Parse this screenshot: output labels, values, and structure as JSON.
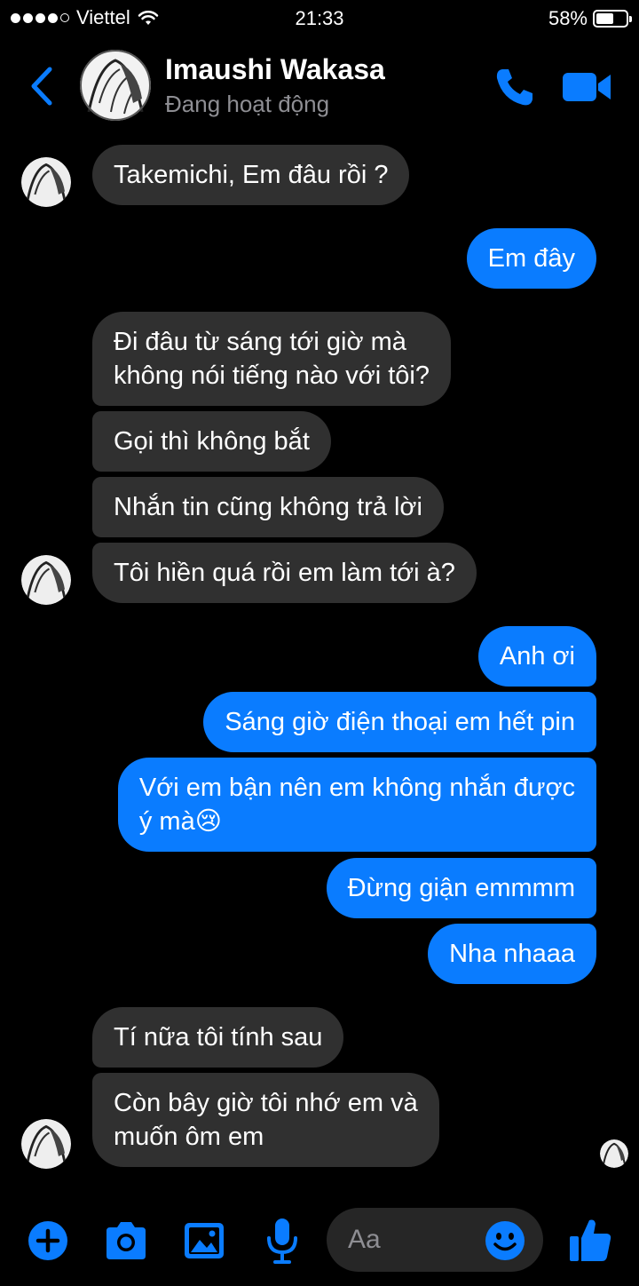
{
  "status_bar": {
    "carrier": "Viettel",
    "time": "21:33",
    "battery": "58%",
    "battery_level": 0.58,
    "icons": [
      "signal-dots-icon",
      "wifi-icon",
      "battery-icon"
    ]
  },
  "header": {
    "contact_name": "Imaushi Wakasa",
    "contact_status": "Đang hoạt động",
    "icons": [
      "back-chevron-icon",
      "phone-icon",
      "video-camera-icon"
    ]
  },
  "messages": [
    {
      "side": "in",
      "text": "Takemichi, Em đâu rồi ?"
    },
    {
      "side": "out",
      "text": "Em đây"
    },
    {
      "side": "in",
      "text": "Đi đâu từ sáng tới giờ mà\nkhông nói tiếng nào với tôi?"
    },
    {
      "side": "in",
      "text": "Gọi thì không bắt"
    },
    {
      "side": "in",
      "text": "Nhắn tin cũng không trả lời"
    },
    {
      "side": "in",
      "text": "Tôi hiền quá rồi em làm tới à?"
    },
    {
      "side": "out",
      "text": "Anh ơi"
    },
    {
      "side": "out",
      "text": "Sáng giờ điện thoại em hết pin"
    },
    {
      "side": "out",
      "text": "Với em bận nên em không nhắn được\ný mà😢"
    },
    {
      "side": "out",
      "text": "Đừng giận emmmm"
    },
    {
      "side": "out",
      "text": "Nha nhaaa"
    },
    {
      "side": "in",
      "text": "Tí nữa tôi tính sau"
    },
    {
      "side": "in",
      "text": "Còn bây giờ tôi nhớ em và\nmuốn ôm em"
    }
  ],
  "composer": {
    "placeholder": "Aa",
    "icons": [
      "plus-icon",
      "camera-icon",
      "gallery-icon",
      "microphone-icon",
      "emoji-icon",
      "thumbs-up-icon"
    ]
  },
  "colors": {
    "accent": "#0a7cff",
    "incoming_bubble": "#303030",
    "background": "#000000",
    "secondary_text": "#8e8e93"
  }
}
